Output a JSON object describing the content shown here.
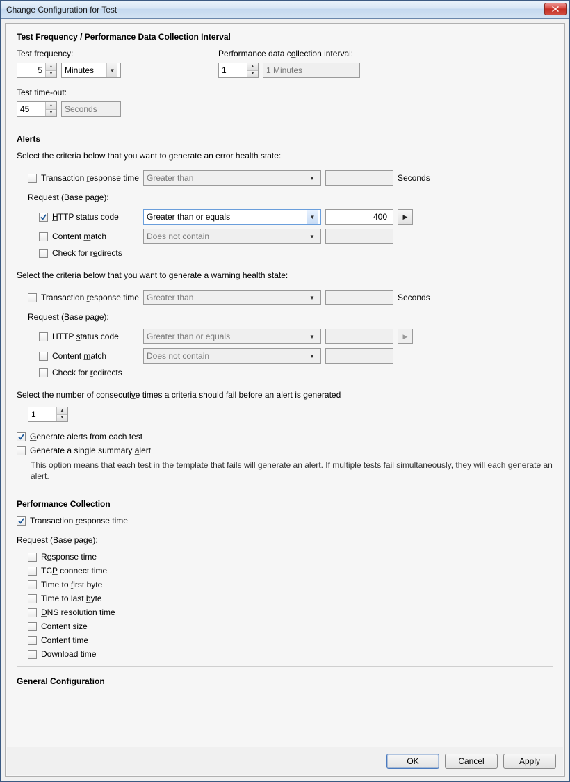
{
  "window": {
    "title": "Change Configuration for Test"
  },
  "section_freq": {
    "heading": "Test Frequency / Performance Data Collection Interval",
    "test_freq_label": "Test frequency:",
    "test_freq_value": "5",
    "test_freq_unit": "Minutes",
    "perf_interval_label": "Performance data collection interval:",
    "perf_interval_value": "1",
    "perf_interval_text": "1 Minutes",
    "timeout_label": "Test time-out:",
    "timeout_value": "45",
    "timeout_unit": "Seconds"
  },
  "section_alerts": {
    "heading": "Alerts",
    "error_intro": "Select the criteria below that you want to generate an error health state:",
    "warning_intro": "Select the criteria below that you want to generate a warning health state:",
    "trt_label": "Transaction response time",
    "trt_op": "Greater than",
    "trt_unit": "Seconds",
    "request_label": "Request (Base page):",
    "http_label": "HTTP status code",
    "http_op": "Greater than or equals",
    "http_val": "400",
    "content_label": "Content match",
    "content_op": "Does not contain",
    "redirect_label": "Check for redirects",
    "consec_label": "Select the number of consecutive times a criteria should fail before an alert is generated",
    "consec_value": "1",
    "gen_each_label": "Generate alerts from each test",
    "gen_summary_label": "Generate a single summary alert",
    "gen_desc": "This option means that each test in the template that fails will generate an alert. If multiple tests fail simultaneously, they will each generate an alert."
  },
  "section_perf": {
    "heading": "Performance Collection",
    "trt_label": "Transaction response time",
    "request_label": "Request (Base page):",
    "items": {
      "response_time": "Response time",
      "tcp": "TCP connect time",
      "ttfb": "Time to first byte",
      "ttlb": "Time to last byte",
      "dns": "DNS resolution time",
      "csize": "Content size",
      "ctime": "Content time",
      "dl": "Download time"
    }
  },
  "section_general": {
    "heading": "General Configuration"
  },
  "buttons": {
    "ok": "OK",
    "cancel": "Cancel",
    "apply": "Apply"
  }
}
